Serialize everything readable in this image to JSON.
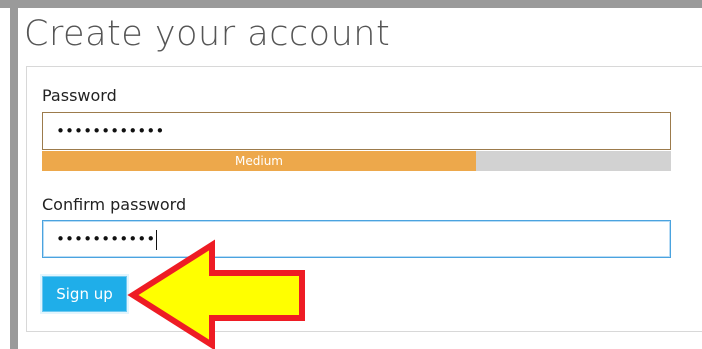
{
  "page": {
    "title": "Create your account"
  },
  "form": {
    "password_label": "Password",
    "password_value": "••••••••••••",
    "strength_label": "Medium",
    "strength_level": 0.69,
    "confirm_label": "Confirm password",
    "confirm_value": "•••••••••••",
    "signup_label": "Sign up"
  },
  "colors": {
    "strength_fill": "#eda84b",
    "strength_track": "#d2d2d2",
    "button": "#1faee9",
    "annotation_arrow_fill": "#ffff00",
    "annotation_arrow_stroke": "#ee1c24"
  },
  "annotation": {
    "icon": "left-arrow-annotation-icon"
  }
}
